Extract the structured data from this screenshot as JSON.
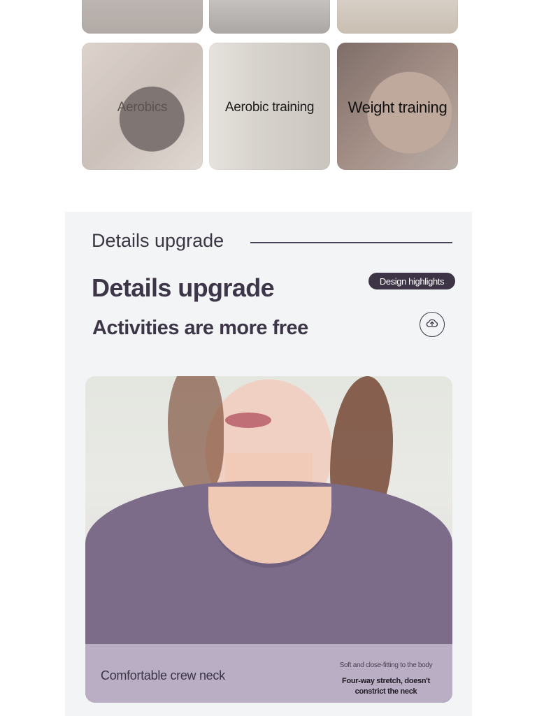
{
  "categories": {
    "tiles": [
      {
        "label": ""
      },
      {
        "label": ""
      },
      {
        "label": ""
      },
      {
        "label": "Aerobics"
      },
      {
        "label": "Aerobic training"
      },
      {
        "label": "Weight training"
      }
    ]
  },
  "details": {
    "section_title": "Details upgrade",
    "heading": "Details upgrade",
    "subheading": "Activities are more free",
    "badge_label": "Design highlights",
    "photo_caption_left": "Comfortable crew neck",
    "photo_caption_right_small": "Soft and close-fitting to the body",
    "photo_caption_right_big": "Four-way stretch, doesn't constrict the neck"
  },
  "icons": {
    "cloud_button": "cloud-upload-icon"
  }
}
